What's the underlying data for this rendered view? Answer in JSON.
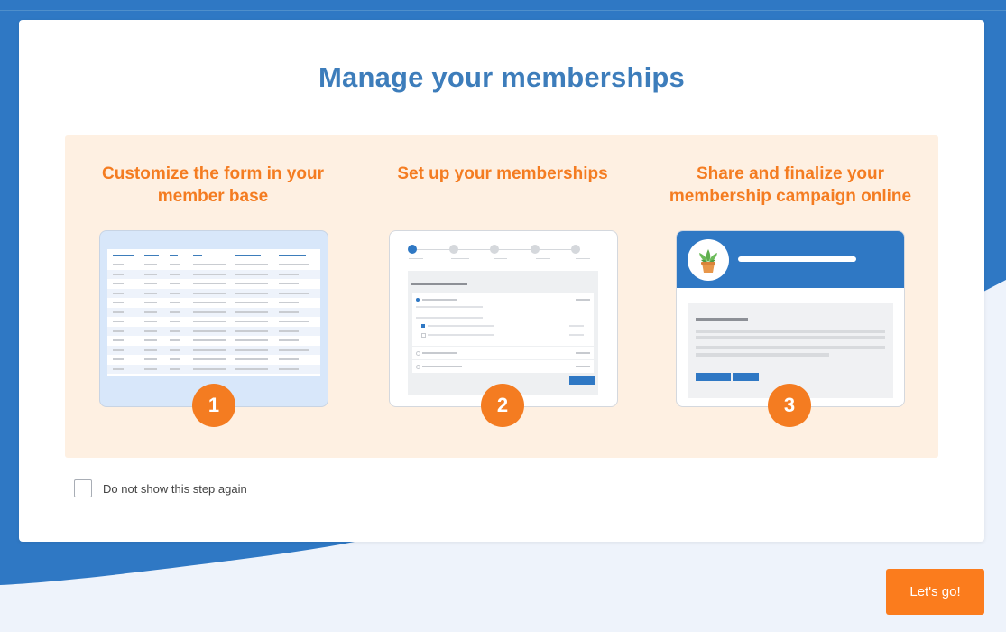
{
  "modal": {
    "title": "Manage your memberships",
    "steps": [
      {
        "title": "Customize the form in your member base",
        "number": "1"
      },
      {
        "title": "Set up your memberships",
        "number": "2"
      },
      {
        "title": "Share and finalize your membership campaign online",
        "number": "3"
      }
    ],
    "dont_show_label": "Do not show this step again"
  },
  "footer": {
    "cta_label": "Let's go!"
  },
  "colors": {
    "brand_blue": "#3d7dbb",
    "accent_orange": "#f47c21",
    "panel_bg": "#fef0e2"
  }
}
